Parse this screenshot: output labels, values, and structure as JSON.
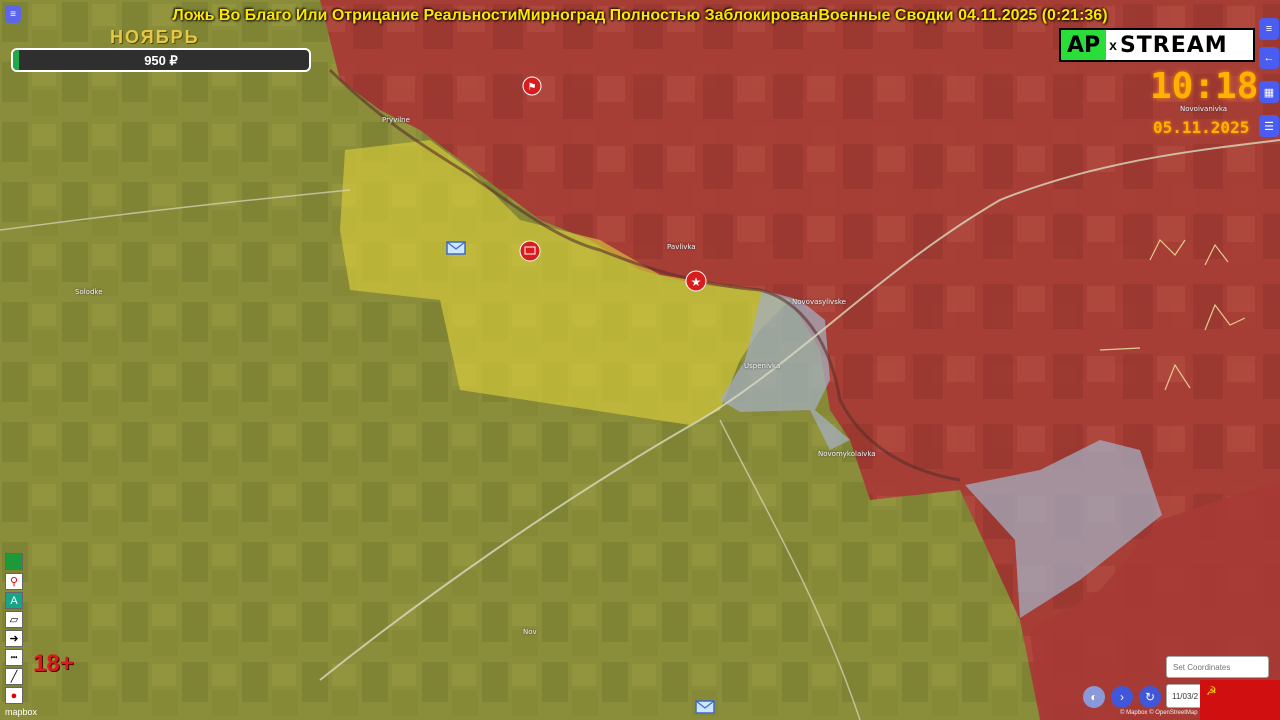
{
  "stream_title": "Ложь Во Благо Или Отрицание РеальностиМирноград Полностью ЗаблокированВоенные Сводки 04.11.2025 (0:21:36)",
  "month_label": "НОЯБРЬ",
  "donation_bar": {
    "amount_label": "950 ₽",
    "fill_fraction": 0.02
  },
  "brand": {
    "left": "AP",
    "separator": "x",
    "right": "STREAM"
  },
  "clock": {
    "time": "10:18",
    "date": "05.11.2025"
  },
  "age_rating": "18+",
  "map": {
    "places": {
      "novoivanivka": "Novoivanivka",
      "pryvilne": "Pryvilne",
      "pavlivka": "Pavlivka",
      "novovasylivske": "Novovasylivske",
      "uspenivka": "Uspenivka",
      "novomykolaivka": "Novomykolaivka",
      "solodke": "Solodke",
      "nov": "Nov"
    },
    "colors": {
      "controlled_red": "#a83a36",
      "contested_yellow": "#cfc63c",
      "gray_zone": "#9aa6b8",
      "farmland": "#8a8d3a"
    },
    "markers": [
      "flag-marker",
      "building-marker",
      "star-marker",
      "mail-marker",
      "mail-marker-bottom"
    ]
  },
  "controls": {
    "set_coordinates_placeholder": "Set Coordinates",
    "date_value": "11/03/2",
    "mapbox_logo": "mapbox",
    "attribution": "© Mapbox © OpenStreetMap"
  },
  "side_buttons": [
    "settings-icon",
    "back-arrow-icon",
    "table-icon",
    "list-icon"
  ],
  "tools": [
    "green-square",
    "pin",
    "text-a",
    "polygon",
    "arrow",
    "dashed-line",
    "line",
    "marker"
  ]
}
